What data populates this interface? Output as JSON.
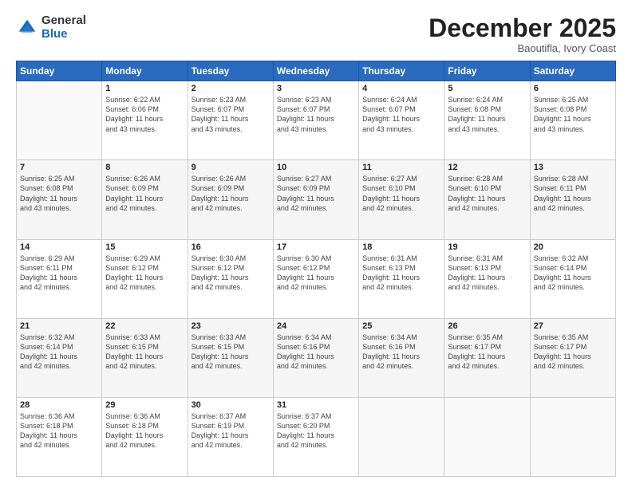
{
  "logo": {
    "general": "General",
    "blue": "Blue"
  },
  "header": {
    "month": "December 2025",
    "location": "Baoutifla, Ivory Coast"
  },
  "weekdays": [
    "Sunday",
    "Monday",
    "Tuesday",
    "Wednesday",
    "Thursday",
    "Friday",
    "Saturday"
  ],
  "weeks": [
    [
      {
        "day": "",
        "info": ""
      },
      {
        "day": "1",
        "info": "Sunrise: 6:22 AM\nSunset: 6:06 PM\nDaylight: 11 hours\nand 43 minutes."
      },
      {
        "day": "2",
        "info": "Sunrise: 6:23 AM\nSunset: 6:07 PM\nDaylight: 11 hours\nand 43 minutes."
      },
      {
        "day": "3",
        "info": "Sunrise: 6:23 AM\nSunset: 6:07 PM\nDaylight: 11 hours\nand 43 minutes."
      },
      {
        "day": "4",
        "info": "Sunrise: 6:24 AM\nSunset: 6:07 PM\nDaylight: 11 hours\nand 43 minutes."
      },
      {
        "day": "5",
        "info": "Sunrise: 6:24 AM\nSunset: 6:08 PM\nDaylight: 11 hours\nand 43 minutes."
      },
      {
        "day": "6",
        "info": "Sunrise: 6:25 AM\nSunset: 6:08 PM\nDaylight: 11 hours\nand 43 minutes."
      }
    ],
    [
      {
        "day": "7",
        "info": "Sunrise: 6:25 AM\nSunset: 6:08 PM\nDaylight: 11 hours\nand 43 minutes."
      },
      {
        "day": "8",
        "info": "Sunrise: 6:26 AM\nSunset: 6:09 PM\nDaylight: 11 hours\nand 42 minutes."
      },
      {
        "day": "9",
        "info": "Sunrise: 6:26 AM\nSunset: 6:09 PM\nDaylight: 11 hours\nand 42 minutes."
      },
      {
        "day": "10",
        "info": "Sunrise: 6:27 AM\nSunset: 6:09 PM\nDaylight: 11 hours\nand 42 minutes."
      },
      {
        "day": "11",
        "info": "Sunrise: 6:27 AM\nSunset: 6:10 PM\nDaylight: 11 hours\nand 42 minutes."
      },
      {
        "day": "12",
        "info": "Sunrise: 6:28 AM\nSunset: 6:10 PM\nDaylight: 11 hours\nand 42 minutes."
      },
      {
        "day": "13",
        "info": "Sunrise: 6:28 AM\nSunset: 6:11 PM\nDaylight: 11 hours\nand 42 minutes."
      }
    ],
    [
      {
        "day": "14",
        "info": "Sunrise: 6:29 AM\nSunset: 6:11 PM\nDaylight: 11 hours\nand 42 minutes."
      },
      {
        "day": "15",
        "info": "Sunrise: 6:29 AM\nSunset: 6:12 PM\nDaylight: 11 hours\nand 42 minutes."
      },
      {
        "day": "16",
        "info": "Sunrise: 6:30 AM\nSunset: 6:12 PM\nDaylight: 11 hours\nand 42 minutes."
      },
      {
        "day": "17",
        "info": "Sunrise: 6:30 AM\nSunset: 6:12 PM\nDaylight: 11 hours\nand 42 minutes."
      },
      {
        "day": "18",
        "info": "Sunrise: 6:31 AM\nSunset: 6:13 PM\nDaylight: 11 hours\nand 42 minutes."
      },
      {
        "day": "19",
        "info": "Sunrise: 6:31 AM\nSunset: 6:13 PM\nDaylight: 11 hours\nand 42 minutes."
      },
      {
        "day": "20",
        "info": "Sunrise: 6:32 AM\nSunset: 6:14 PM\nDaylight: 11 hours\nand 42 minutes."
      }
    ],
    [
      {
        "day": "21",
        "info": "Sunrise: 6:32 AM\nSunset: 6:14 PM\nDaylight: 11 hours\nand 42 minutes."
      },
      {
        "day": "22",
        "info": "Sunrise: 6:33 AM\nSunset: 6:15 PM\nDaylight: 11 hours\nand 42 minutes."
      },
      {
        "day": "23",
        "info": "Sunrise: 6:33 AM\nSunset: 6:15 PM\nDaylight: 11 hours\nand 42 minutes."
      },
      {
        "day": "24",
        "info": "Sunrise: 6:34 AM\nSunset: 6:16 PM\nDaylight: 11 hours\nand 42 minutes."
      },
      {
        "day": "25",
        "info": "Sunrise: 6:34 AM\nSunset: 6:16 PM\nDaylight: 11 hours\nand 42 minutes."
      },
      {
        "day": "26",
        "info": "Sunrise: 6:35 AM\nSunset: 6:17 PM\nDaylight: 11 hours\nand 42 minutes."
      },
      {
        "day": "27",
        "info": "Sunrise: 6:35 AM\nSunset: 6:17 PM\nDaylight: 11 hours\nand 42 minutes."
      }
    ],
    [
      {
        "day": "28",
        "info": "Sunrise: 6:36 AM\nSunset: 6:18 PM\nDaylight: 11 hours\nand 42 minutes."
      },
      {
        "day": "29",
        "info": "Sunrise: 6:36 AM\nSunset: 6:18 PM\nDaylight: 11 hours\nand 42 minutes."
      },
      {
        "day": "30",
        "info": "Sunrise: 6:37 AM\nSunset: 6:19 PM\nDaylight: 11 hours\nand 42 minutes."
      },
      {
        "day": "31",
        "info": "Sunrise: 6:37 AM\nSunset: 6:20 PM\nDaylight: 11 hours\nand 42 minutes."
      },
      {
        "day": "",
        "info": ""
      },
      {
        "day": "",
        "info": ""
      },
      {
        "day": "",
        "info": ""
      }
    ]
  ]
}
